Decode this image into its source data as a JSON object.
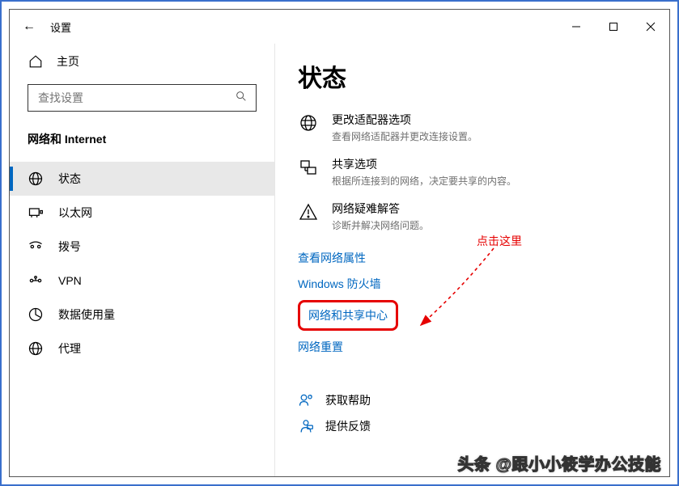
{
  "titlebar": {
    "back_label": "←",
    "title": "设置"
  },
  "sidebar": {
    "home_label": "主页",
    "search_placeholder": "查找设置",
    "section_label": "网络和 Internet",
    "items": [
      {
        "label": "状态",
        "icon": "status",
        "selected": true
      },
      {
        "label": "以太网",
        "icon": "ethernet",
        "selected": false
      },
      {
        "label": "拨号",
        "icon": "dialup",
        "selected": false
      },
      {
        "label": "VPN",
        "icon": "vpn",
        "selected": false
      },
      {
        "label": "数据使用量",
        "icon": "data",
        "selected": false
      },
      {
        "label": "代理",
        "icon": "proxy",
        "selected": false
      }
    ]
  },
  "main": {
    "page_title": "状态",
    "options": [
      {
        "title": "更改适配器选项",
        "desc": "查看网络适配器并更改连接设置。",
        "icon": "adapter"
      },
      {
        "title": "共享选项",
        "desc": "根据所连接到的网络，决定要共享的内容。",
        "icon": "share"
      },
      {
        "title": "网络疑难解答",
        "desc": "诊断并解决网络问题。",
        "icon": "troubleshoot"
      }
    ],
    "links": {
      "view_props": "查看网络属性",
      "firewall": "Windows 防火墙",
      "sharing_center": "网络和共享中心",
      "reset": "网络重置"
    },
    "help_rows": {
      "get_help": "获取帮助",
      "feedback": "提供反馈"
    }
  },
  "annotation": {
    "text": "点击这里"
  },
  "watermark": "头条 @跟小小筱学办公技能"
}
